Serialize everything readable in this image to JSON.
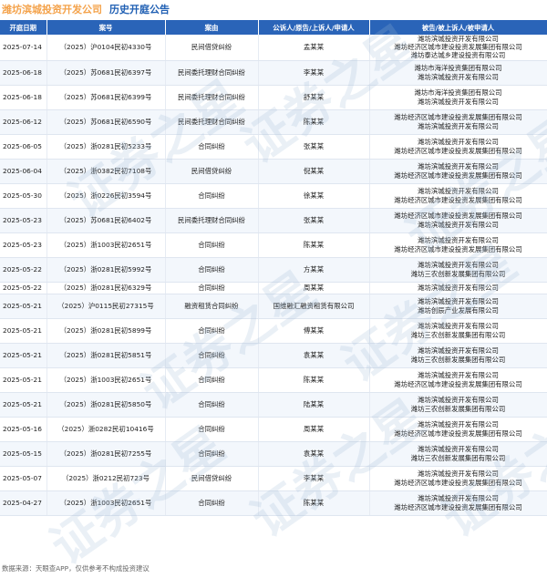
{
  "header": {
    "company": "潍坊滨城投资开发公司",
    "title": "历史开庭公告"
  },
  "columns": [
    "开庭日期",
    "案号",
    "案由",
    "公诉人/原告/上诉人/申请人",
    "被告/被上诉人/被申请人"
  ],
  "rows": [
    {
      "date": "2025-07-14",
      "case_no": "（2025）沪0104民初4330号",
      "cause": "民间借贷纠纷",
      "plaintiff": "孟某某",
      "defendants": [
        "潍坊滨城投资开发有限公司",
        "潍坊经济区城市建设投资发展集团有限公司",
        "潍坊泰达城乡建设投资有限公司"
      ]
    },
    {
      "date": "2025-06-18",
      "case_no": "（2025）苏0681民初6397号",
      "cause": "民间委托理财合同纠纷",
      "plaintiff": "李某某",
      "defendants": [
        "潍坊市海洋投资集团有限公司",
        "潍坊滨城投资开发有限公司"
      ]
    },
    {
      "date": "2025-06-18",
      "case_no": "（2025）苏0681民初6399号",
      "cause": "民间委托理财合同纠纷",
      "plaintiff": "舒某某",
      "defendants": [
        "潍坊市海洋投资集团有限公司",
        "潍坊滨城投资开发有限公司"
      ]
    },
    {
      "date": "2025-06-12",
      "case_no": "（2025）苏0681民初6590号",
      "cause": "民间委托理财合同纠纷",
      "plaintiff": "陈某某",
      "defendants": [
        "潍坊经济区城市建设投资发展集团有限公司",
        "潍坊滨城投资开发有限公司"
      ]
    },
    {
      "date": "2025-06-05",
      "case_no": "（2025）浙0281民初5233号",
      "cause": "合同纠纷",
      "plaintiff": "张某某",
      "defendants": [
        "潍坊滨城投资开发有限公司",
        "潍坊经济区城市建设投资发展集团有限公司"
      ]
    },
    {
      "date": "2025-06-04",
      "case_no": "（2025）浙0382民初7108号",
      "cause": "民间借贷纠纷",
      "plaintiff": "倪某某",
      "defendants": [
        "潍坊滨城投资开发有限公司",
        "潍坊经济区城市建设投资发展集团有限公司"
      ]
    },
    {
      "date": "2025-05-30",
      "case_no": "（2025）浙0226民初3594号",
      "cause": "合同纠纷",
      "plaintiff": "徐某某",
      "defendants": [
        "潍坊滨城投资开发有限公司",
        "潍坊经济区城市建设投资发展集团有限公司"
      ]
    },
    {
      "date": "2025-05-23",
      "case_no": "（2025）苏0681民初6402号",
      "cause": "民间委托理财合同纠纷",
      "plaintiff": "张某某",
      "defendants": [
        "潍坊经济区城市建设投资发展集团有限公司",
        "潍坊滨城投资开发有限公司"
      ]
    },
    {
      "date": "2025-05-23",
      "case_no": "（2025）浙1003民初2651号",
      "cause": "合同纠纷",
      "plaintiff": "陈某某",
      "defendants": [
        "潍坊滨城投资开发有限公司",
        "潍坊经济区城市建设投资发展集团有限公司"
      ]
    },
    {
      "date": "2025-05-22",
      "case_no": "（2025）浙0281民初5992号",
      "cause": "合同纠纷",
      "plaintiff": "方某某",
      "defendants": [
        "潍坊滨城投资开发有限公司",
        "潍坊三农创新发展集团有限公司"
      ]
    },
    {
      "date": "2025-05-22",
      "case_no": "（2025）浙0281民初6329号",
      "cause": "合同纠纷",
      "plaintiff": "周某某",
      "defendants": [
        "潍坊滨城投资开发有限公司"
      ]
    },
    {
      "date": "2025-05-21",
      "case_no": "（2025）沪0115民初27315号",
      "cause": "融资租赁合同纠纷",
      "plaintiff": "国维融汇融资租赁有限公司",
      "defendants": [
        "潍坊滨城投资开发有限公司",
        "潍坊创辰产业发展有限公司"
      ]
    },
    {
      "date": "2025-05-21",
      "case_no": "（2025）浙0281民初5899号",
      "cause": "合同纠纷",
      "plaintiff": "傅某某",
      "defendants": [
        "潍坊滨城投资开发有限公司",
        "潍坊三农创新发展集团有限公司"
      ]
    },
    {
      "date": "2025-05-21",
      "case_no": "（2025）浙0281民初5851号",
      "cause": "合同纠纷",
      "plaintiff": "袁某某",
      "defendants": [
        "潍坊滨城投资开发有限公司",
        "潍坊三农创新发展集团有限公司"
      ]
    },
    {
      "date": "2025-05-21",
      "case_no": "（2025）浙1003民初2651号",
      "cause": "合同纠纷",
      "plaintiff": "陈某某",
      "defendants": [
        "潍坊滨城投资开发有限公司",
        "潍坊经济区城市建设投资发展集团有限公司"
      ]
    },
    {
      "date": "2025-05-21",
      "case_no": "（2025）浙0281民初5850号",
      "cause": "合同纠纷",
      "plaintiff": "陆某某",
      "defendants": [
        "潍坊滨城投资开发有限公司",
        "潍坊三农创新发展集团有限公司"
      ]
    },
    {
      "date": "2025-05-16",
      "case_no": "（2025）浙0282民初10416号",
      "cause": "合同纠纷",
      "plaintiff": "周某某",
      "defendants": [
        "潍坊滨城投资开发有限公司",
        "潍坊经济区城市建设投资发展集团有限公司"
      ]
    },
    {
      "date": "2025-05-15",
      "case_no": "（2025）浙0281民初7255号",
      "cause": "合同纠纷",
      "plaintiff": "袁某某",
      "defendants": [
        "潍坊滨城投资开发有限公司",
        "潍坊三农创新发展集团有限公司"
      ]
    },
    {
      "date": "2025-05-07",
      "case_no": "（2025）浙0212民初723号",
      "cause": "民间借贷纠纷",
      "plaintiff": "李某某",
      "defendants": [
        "潍坊滨城投资开发有限公司",
        "潍坊经济区城市建设投资发展集团有限公司"
      ]
    },
    {
      "date": "2025-04-27",
      "case_no": "（2025）浙1003民初2651号",
      "cause": "合同纠纷",
      "plaintiff": "陈某某",
      "defendants": [
        "潍坊滨城投资开发有限公司",
        "潍坊经济区城市建设投资发展集团有限公司"
      ]
    }
  ],
  "footer": "数据来源：天眼查APP，仅供参考不构成投资建议",
  "watermark": "证券之星"
}
